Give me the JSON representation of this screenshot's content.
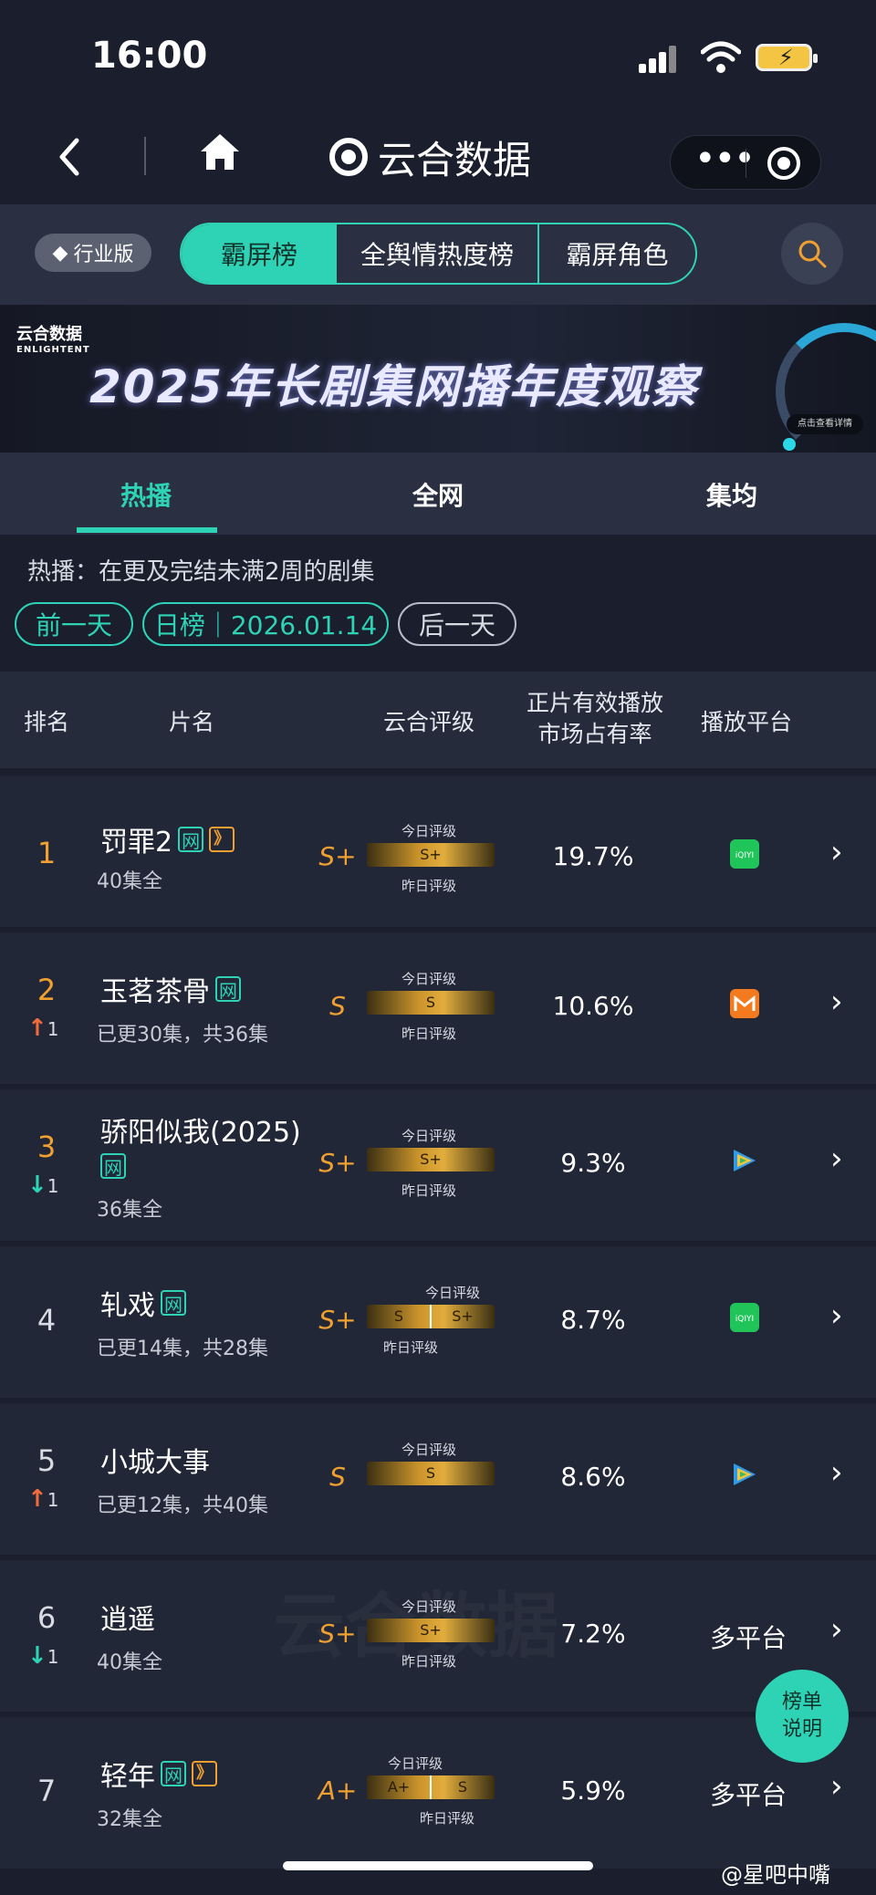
{
  "status": {
    "time": "16:00"
  },
  "nav": {
    "back_icon": "chevron-left-icon",
    "home_icon": "home-icon",
    "title": "云合数据",
    "more_icon": "more-dots-icon",
    "close_icon": "target-icon"
  },
  "filters": {
    "edition_badge": "行业版",
    "segments": [
      "霸屏榜",
      "全舆情热度榜",
      "霸屏角色"
    ],
    "active_segment": "霸屏榜",
    "search_icon": "search-icon",
    "accent_color": "#2ed3b5"
  },
  "banner": {
    "logo": "云合数据",
    "logo_sub": "ENLIGHTENT",
    "title": "2025年长剧集网播年度观察",
    "cta": "点击查看详情"
  },
  "subtabs": {
    "items": [
      "热播",
      "全网",
      "集均"
    ],
    "active": "热播"
  },
  "description": "热播：在更及完结未满2周的剧集",
  "date_nav": {
    "prev": "前一天",
    "current": "日榜｜2026.01.14",
    "next": "后一天"
  },
  "table": {
    "headers": {
      "rank": "排名",
      "name": "片名",
      "grade": "云合评级",
      "share": "正片有效播放\n市场占有率",
      "platform": "播放平台"
    },
    "today_label": "今日评级",
    "yesterday_label": "昨日评级",
    "rows": [
      {
        "rank": "1",
        "name": "罚罪2",
        "tag_w": "网",
        "tag_v": "》",
        "episodes": "40集全",
        "grade": "S+",
        "today": "S+",
        "yesterday": "",
        "share": "19.7%",
        "platform": "iqiyi-icon",
        "platform_text": ""
      },
      {
        "rank": "2",
        "change_dir": "↑",
        "change": "1",
        "name": "玉茗茶骨",
        "tag_w": "网",
        "episodes": "已更30集，共36集",
        "grade": "S",
        "today": "S",
        "yesterday": "",
        "share": "10.6%",
        "platform": "mango-icon",
        "platform_text": ""
      },
      {
        "rank": "3",
        "change_dir": "↓",
        "change": "1",
        "name": "骄阳似我(2025)",
        "tag_w": "网",
        "episodes": "36集全",
        "grade": "S+",
        "today": "S+",
        "yesterday": "",
        "share": "9.3%",
        "platform": "tencent-video-icon",
        "platform_text": ""
      },
      {
        "rank": "4",
        "name": "轧戏",
        "tag_w": "网",
        "episodes": "已更14集，共28集",
        "grade": "S+",
        "today": "S+",
        "yesterday": "S",
        "share": "8.7%",
        "platform": "iqiyi-icon",
        "platform_text": ""
      },
      {
        "rank": "5",
        "change_dir": "↑",
        "change": "1",
        "name": "小城大事",
        "episodes": "已更12集，共40集",
        "grade": "S",
        "today": "S",
        "yesterday": "",
        "share": "8.6%",
        "platform": "tencent-video-icon",
        "platform_text": ""
      },
      {
        "rank": "6",
        "change_dir": "↓",
        "change": "1",
        "name": "逍遥",
        "episodes": "40集全",
        "grade": "S+",
        "today": "S+",
        "yesterday": "",
        "share": "7.2%",
        "platform": "",
        "platform_text": "多平台"
      },
      {
        "rank": "7",
        "name": "轻年",
        "tag_w": "网",
        "tag_v": "》",
        "episodes": "32集全",
        "grade": "A+",
        "today": "A+",
        "yesterday": "S",
        "share": "5.9%",
        "platform": "",
        "platform_text": "多平台"
      }
    ]
  },
  "fab": {
    "line1": "榜单",
    "line2": "说明"
  },
  "watermark": "云合数据",
  "weibo": "@星吧中嘴"
}
